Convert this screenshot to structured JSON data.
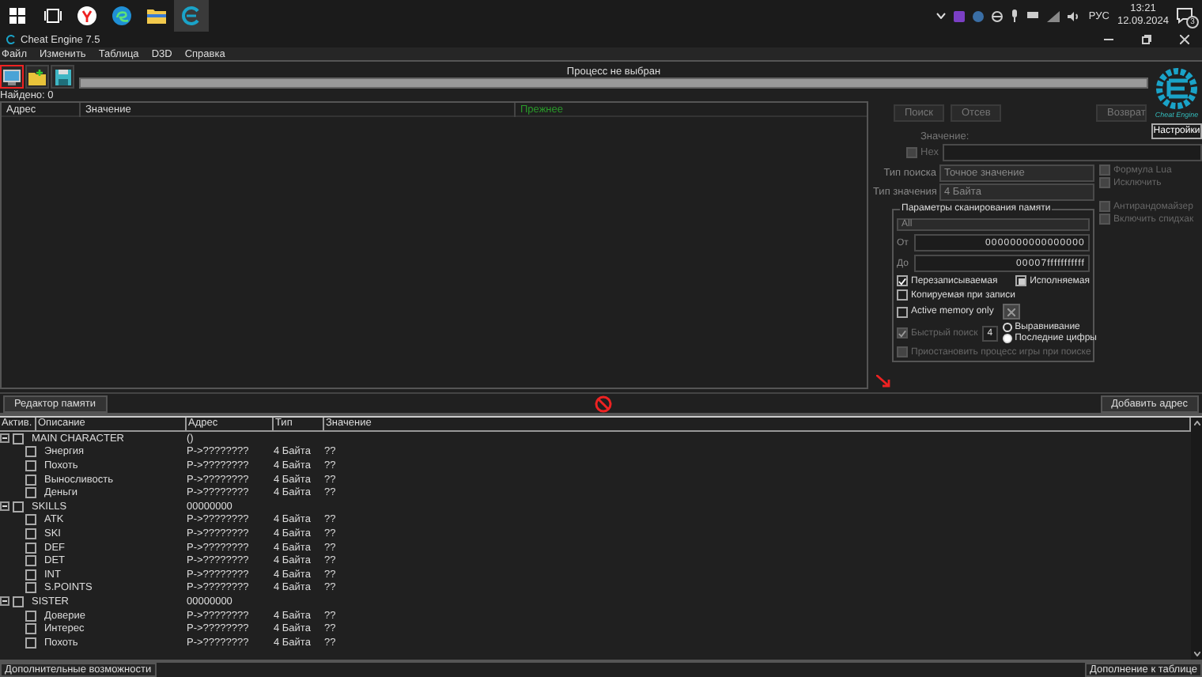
{
  "taskbar": {
    "apps": [
      {
        "kind": "start",
        "selected": false
      },
      {
        "kind": "taskview",
        "selected": false
      },
      {
        "kind": "browser",
        "selected": false
      },
      {
        "kind": "edge",
        "selected": false
      },
      {
        "kind": "folder",
        "selected": false
      },
      {
        "kind": "cheatengine",
        "selected": true
      }
    ],
    "language": "РУС",
    "time": "13:21",
    "date": "12.09.2024",
    "notification_count": "3"
  },
  "window": {
    "title": "Cheat Engine 7.5"
  },
  "menu": [
    "Файл",
    "Изменить",
    "Таблица",
    "D3D",
    "Справка"
  ],
  "process": {
    "label": "Процесс не выбран"
  },
  "found": "Найдено: 0",
  "results": {
    "columns": [
      "Адрес",
      "Значение",
      "Прежнее"
    ]
  },
  "scan": {
    "buttons": [
      {
        "label": "Поиск",
        "disabled": true
      },
      {
        "label": "Отсев",
        "disabled": true
      },
      {
        "label": "Возврат",
        "disabled": true
      }
    ],
    "logo_text": "Cheat Engine",
    "settings_button": "Настройки",
    "value_label": "Значение:",
    "hex": {
      "label": "Hex",
      "checked": false,
      "disabled": true
    },
    "search_type": {
      "label": "Тип поиска",
      "value": "Точное значение"
    },
    "value_type": {
      "label": "Тип значения",
      "value": "4 Байта"
    },
    "side_options": [
      {
        "label": "Формула Lua",
        "checked": false,
        "disabled": true
      },
      {
        "label": "Исключить",
        "checked": false,
        "disabled": true
      }
    ],
    "memory": {
      "title": "Параметры сканирования памяти",
      "region": "All",
      "from_label": "От",
      "from": "0000000000000000",
      "to_label": "До",
      "to": "00007fffffffffff",
      "writable": {
        "label": "Перезаписываемая",
        "checked": true
      },
      "executable": {
        "label": "Исполняемая",
        "partial": true
      },
      "copy_on_write": {
        "label": "Копируемая при записи",
        "checked": false
      },
      "active_memory_only": {
        "label": "Active memory only",
        "checked": false
      },
      "fast_scan": {
        "label": "Быстрый поиск",
        "checked": true,
        "disabled": true,
        "value": "4"
      },
      "alignment": [
        {
          "label": "Выравнивание",
          "selected": false
        },
        {
          "label": "Последние цифры",
          "selected": true
        }
      ],
      "pause": {
        "label": "Приостановить процесс игры при поиске",
        "checked": false,
        "disabled": true
      }
    },
    "extra_options": [
      {
        "label": "Антирандомайзер",
        "checked": false,
        "disabled": true
      },
      {
        "label": "Включить спидхак",
        "checked": false,
        "disabled": true
      }
    ]
  },
  "memory_view_button": "Редактор памяти",
  "add_address_button": "Добавить адрес",
  "table": {
    "columns": [
      "Актив.",
      "Описание",
      "Адрес",
      "Тип",
      "Значение"
    ],
    "rows": [
      {
        "description": "MAIN CHARACTER",
        "address": "()",
        "active": false,
        "expanded": true,
        "children": [
          {
            "description": "Энергия",
            "address": "P->????????",
            "type": "4 Байта",
            "value": "??",
            "active": false
          },
          {
            "description": "Похоть",
            "address": "P->????????",
            "type": "4 Байта",
            "value": "??",
            "active": false
          },
          {
            "description": "Выносливость",
            "address": "P->????????",
            "type": "4 Байта",
            "value": "??",
            "active": false
          },
          {
            "description": "Деньги",
            "address": "P->????????",
            "type": "4 Байта",
            "value": "??",
            "active": false
          }
        ]
      },
      {
        "description": "SKILLS",
        "address": "00000000",
        "active": false,
        "expanded": true,
        "children": [
          {
            "description": "ATK",
            "address": "P->????????",
            "type": "4 Байта",
            "value": "??",
            "active": false
          },
          {
            "description": "SKI",
            "address": "P->????????",
            "type": "4 Байта",
            "value": "??",
            "active": false
          },
          {
            "description": "DEF",
            "address": "P->????????",
            "type": "4 Байта",
            "value": "??",
            "active": false
          },
          {
            "description": "DET",
            "address": "P->????????",
            "type": "4 Байта",
            "value": "??",
            "active": false
          },
          {
            "description": "INT",
            "address": "P->????????",
            "type": "4 Байта",
            "value": "??",
            "active": false
          },
          {
            "description": "S.POINTS",
            "address": "P->????????",
            "type": "4 Байта",
            "value": "??",
            "active": false
          }
        ]
      },
      {
        "description": "SISTER",
        "address": "00000000",
        "active": false,
        "expanded": true,
        "children": [
          {
            "description": "Доверие",
            "address": "P->????????",
            "type": "4 Байта",
            "value": "??",
            "active": false
          },
          {
            "description": "Интерес",
            "address": "P->????????",
            "type": "4 Байта",
            "value": "??",
            "active": false
          },
          {
            "description": "Похоть",
            "address": "P->????????",
            "type": "4 Байта",
            "value": "??",
            "active": false
          }
        ]
      }
    ]
  },
  "status": {
    "left": "Дополнительные возможности",
    "right": "Дополнение к таблице"
  }
}
